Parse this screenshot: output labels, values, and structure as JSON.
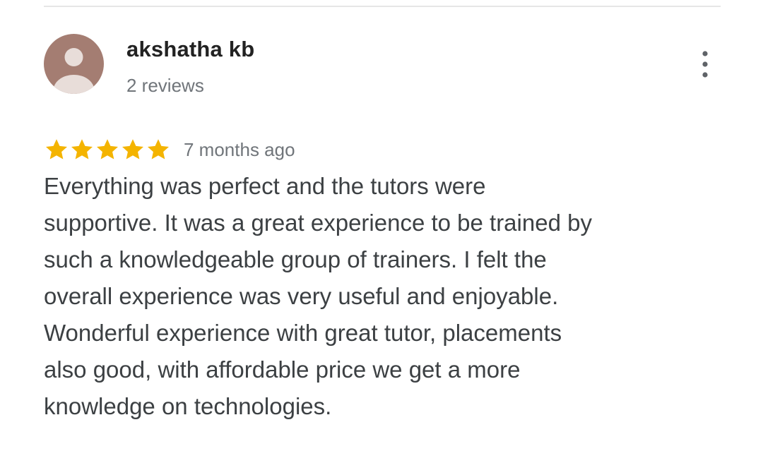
{
  "review": {
    "reviewer_name": "akshatha kb",
    "review_count": "2 reviews",
    "rating": 5,
    "rating_max": 5,
    "time_ago": "7 months ago",
    "text_lines": [
      "Everything was perfect and the tutors were",
      "supportive. It was a great experience to be trained by",
      "such a knowledgeable group of trainers. I felt the",
      "overall experience was very useful and enjoyable.",
      "Wonderful experience with great tutor, placements",
      "also good, with affordable price we get a more",
      "knowledge on technologies."
    ]
  },
  "icons": {
    "avatar": "person-avatar-icon",
    "more": "more-vert-icon",
    "star": "star-icon"
  },
  "colors": {
    "avatar_bg": "#a47d72",
    "avatar_fg": "#e8ddd9",
    "star": "#f4b400",
    "name": "#222222",
    "meta": "#70757a",
    "body": "#3c4043",
    "divider": "#e6e6e6"
  }
}
